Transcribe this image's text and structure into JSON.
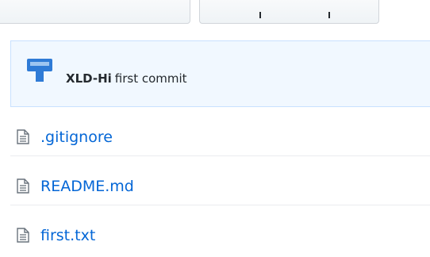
{
  "commit": {
    "author": "XLD-Hi",
    "message": "first commit"
  },
  "files": [
    {
      "name": ".gitignore",
      "icon": "file-text-icon"
    },
    {
      "name": "README.md",
      "icon": "file-text-icon"
    },
    {
      "name": "first.txt",
      "icon": "file-text-icon"
    }
  ],
  "colors": {
    "link": "#0366d6",
    "commit_bar_bg": "#f1f8ff",
    "avatar": "#2f7bd6"
  }
}
